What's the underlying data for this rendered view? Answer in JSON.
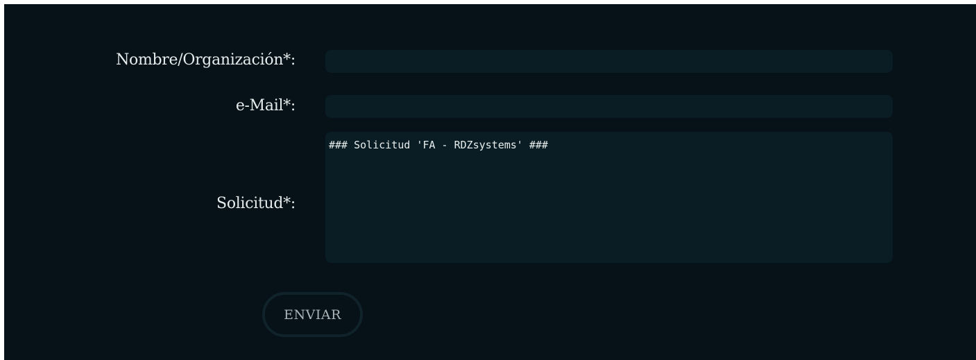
{
  "form": {
    "name_label": "Nombre/Organización*:",
    "email_label": "e-Mail*:",
    "request_label": "Solicitud*:",
    "name_value": "",
    "email_value": "",
    "request_value": "### Solicitud 'FA - RDZsystems' ###",
    "submit_label": "ENVIAR"
  },
  "colors": {
    "background": "#061118",
    "field_background": "#0b1d24",
    "label_text": "#e6ecec",
    "button_text": "#aab3b6",
    "button_border": "#10222a"
  }
}
